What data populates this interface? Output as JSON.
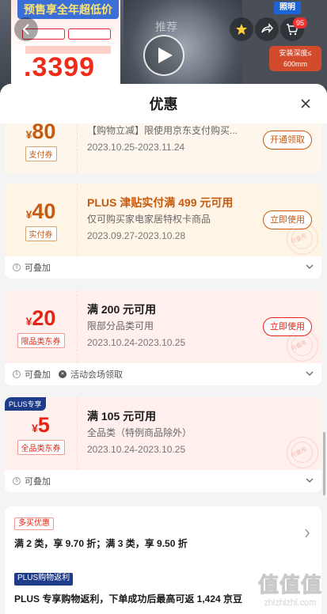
{
  "background": {
    "promo_banner": "预售享全年超低价",
    "promo_tags": [
      "",
      ""
    ],
    "promo_coupon_line": "",
    "promo_price": ".3399",
    "brand_badge": "照明",
    "tab_faded": "推荐",
    "depth_box_line1": "安装深度≤",
    "depth_box_line2": "600mm",
    "cart_count": "95"
  },
  "sheet": {
    "title": "优惠"
  },
  "coupons": [
    {
      "amount": "80",
      "currency": "¥",
      "tag": "支付券",
      "title": "",
      "desc": "【购物立减】限使用京东支付购买...",
      "date": "2023.10.25-2023.11.24",
      "button": "开通领取"
    },
    {
      "amount": "40",
      "currency": "¥",
      "tag": "实付券",
      "title": "PLUS 津贴实付满 499 元可用",
      "desc": "仅可购买家电家居特权卡商品",
      "date": "2023.09.27-2023.10.28",
      "button": "立即使用",
      "stamp": "可叠用",
      "footer": [
        "可叠加"
      ]
    },
    {
      "amount": "20",
      "currency": "¥",
      "tag": "限品类东券",
      "title": "满 200 元可用",
      "desc": "限部分品类可用",
      "date": "2023.10.24-2023.10.25",
      "button": "立即使用",
      "stamp": "可叠用",
      "footer": [
        "可叠加",
        "活动会场领取"
      ]
    },
    {
      "corner": "PLUS专享",
      "amount": "5",
      "currency": "¥",
      "tag": "全品类东券",
      "title": "满 105 元可用",
      "desc": "全品类（特例商品除外）",
      "date": "2023.10.24-2023.10.25",
      "stamp": "可叠用",
      "footer": [
        "可叠加"
      ]
    }
  ],
  "promotions": [
    {
      "label": "多买优惠",
      "text": "满 2 类，享 9.70 折；满 3 类，享 9.50 折"
    },
    {
      "label": "PLUS购物返利",
      "text": "PLUS 专享购物返利，下单成功后最高可返 1,424 京豆"
    }
  ],
  "watermark": {
    "logo": "值值值",
    "url": "zhizhizhi.com"
  },
  "colors": {
    "accent_red": "#e52416",
    "gold": "#c55a11",
    "plus_blue": "#1e3c8a"
  }
}
